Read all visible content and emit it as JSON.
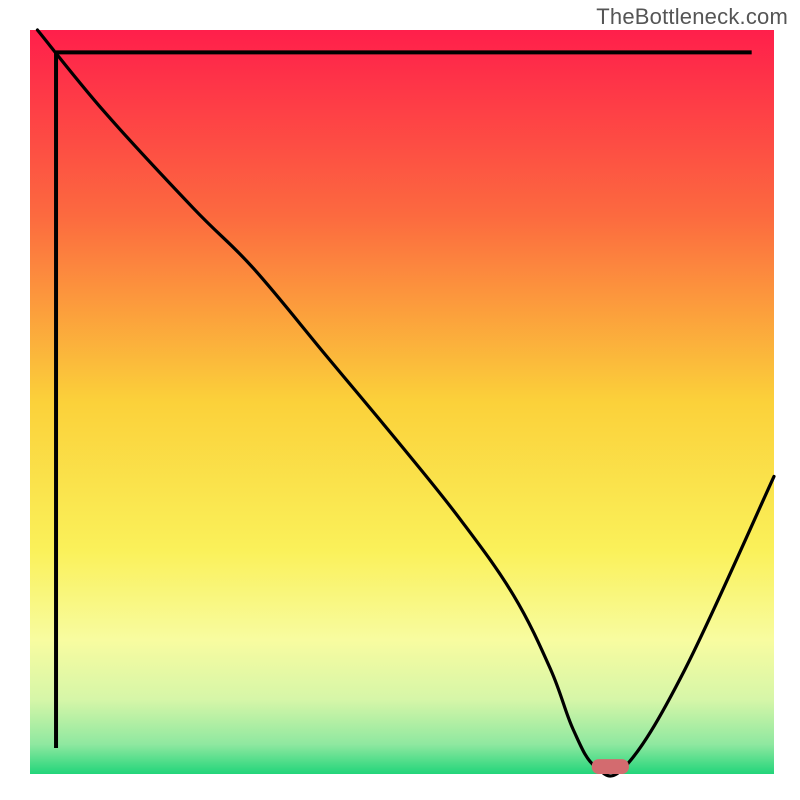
{
  "watermark": "TheBottleneck.com",
  "chart_data": {
    "type": "line",
    "title": "",
    "xlabel": "",
    "ylabel": "",
    "xlim": [
      0,
      100
    ],
    "ylim": [
      0,
      100
    ],
    "grid": false,
    "legend": false,
    "gradient_stops": [
      {
        "offset": 0.0,
        "color": "#ff1f4b"
      },
      {
        "offset": 0.25,
        "color": "#fc6a3f"
      },
      {
        "offset": 0.5,
        "color": "#fbd13a"
      },
      {
        "offset": 0.7,
        "color": "#faf15a"
      },
      {
        "offset": 0.82,
        "color": "#f8fca0"
      },
      {
        "offset": 0.9,
        "color": "#d6f6a8"
      },
      {
        "offset": 0.96,
        "color": "#8fe8a0"
      },
      {
        "offset": 1.0,
        "color": "#22d57a"
      }
    ],
    "series": [
      {
        "name": "bottleneck-curve",
        "x": [
          1,
          10,
          22,
          30,
          40,
          50,
          58,
          65,
          70,
          73,
          76,
          80,
          88,
          100
        ],
        "y": [
          100,
          89,
          76,
          68,
          56,
          44,
          34,
          24,
          14,
          6,
          1,
          1,
          14,
          40
        ]
      }
    ],
    "marker": {
      "name": "optimal-point",
      "x": 78,
      "y": 1,
      "color": "#d36b6f",
      "w": 5,
      "h": 2
    },
    "axes": {
      "left": {
        "x": 3.5,
        "y0": 3.5,
        "y1": 97
      },
      "bottom": {
        "y": 97,
        "x0": 3.5,
        "x1": 97
      }
    }
  }
}
